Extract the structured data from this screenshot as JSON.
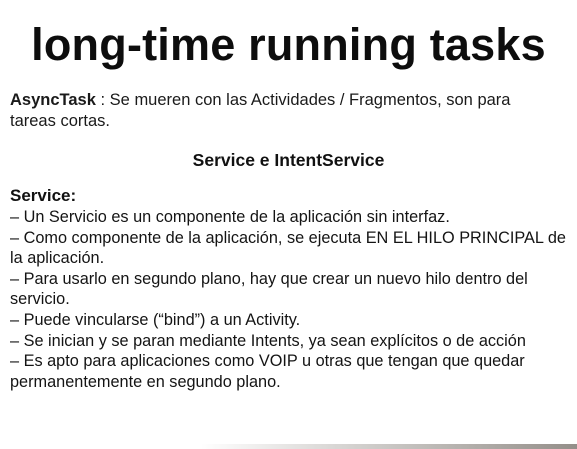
{
  "slide": {
    "title": "long-time running tasks",
    "intro": {
      "term": "AsyncTask",
      "text": " : Se mueren con las Actividades / Fragmentos, son para tareas cortas."
    },
    "subtitle": "Service e IntentService",
    "section_heading": "Service:",
    "bullets": [
      "– Un Servicio es un componente de la aplicación sin interfaz.",
      "– Como componente de la aplicación, se ejecuta EN EL HILO PRINCIPAL de la aplicación.",
      "– Para usarlo en segundo plano, hay que crear un nuevo hilo dentro del servicio.",
      "– Puede vincularse (“bind”) a un Activity.",
      "– Se inician y se paran mediante Intents, ya sean explícitos o de acción",
      "– Es apto para aplicaciones como VOIP u otras que tengan que quedar permanentemente en segundo plano."
    ]
  }
}
